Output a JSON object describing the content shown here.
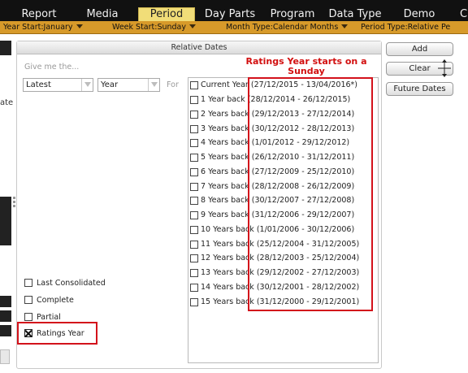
{
  "top_tabs": [
    {
      "label": "Report"
    },
    {
      "label": "Media"
    },
    {
      "label": "Period",
      "active": true
    },
    {
      "label": "Day Parts"
    },
    {
      "label": "Program"
    },
    {
      "label": "Data Type"
    },
    {
      "label": "Demo"
    },
    {
      "label": "C"
    }
  ],
  "sub_bar": [
    {
      "label": "Year Start:January"
    },
    {
      "label": "Week Start:Sunday"
    },
    {
      "label": "Month Type:Calendar Months"
    },
    {
      "label": "Period Type:Relative Pe"
    }
  ],
  "left_strip": {
    "partial_text": "ate"
  },
  "panel": {
    "title": "Relative Dates",
    "give_me_label": "Give me the...",
    "latest_select": "Latest",
    "unit_select": "Year",
    "for_label": "For"
  },
  "periods": [
    {
      "label": "Current Year",
      "range": "(27/12/2015 - 13/04/2016*)"
    },
    {
      "label": "1 Year back",
      "range": "(28/12/2014 - 26/12/2015)"
    },
    {
      "label": "2 Years back",
      "range": "(29/12/2013 - 27/12/2014)"
    },
    {
      "label": "3 Years back",
      "range": "(30/12/2012 - 28/12/2013)"
    },
    {
      "label": "4 Years back",
      "range": "(1/01/2012 - 29/12/2012)"
    },
    {
      "label": "5 Years back",
      "range": "(26/12/2010 - 31/12/2011)"
    },
    {
      "label": "6 Years back",
      "range": "(27/12/2009 - 25/12/2010)"
    },
    {
      "label": "7 Years back",
      "range": "(28/12/2008 - 26/12/2009)"
    },
    {
      "label": "8 Years back",
      "range": "(30/12/2007 - 27/12/2008)"
    },
    {
      "label": "9 Years back",
      "range": "(31/12/2006 - 29/12/2007)"
    },
    {
      "label": "10 Years back",
      "range": "(1/01/2006 - 30/12/2006)"
    },
    {
      "label": "11 Years back",
      "range": "(25/12/2004 - 31/12/2005)"
    },
    {
      "label": "12 Years back",
      "range": "(28/12/2003 - 25/12/2004)"
    },
    {
      "label": "13 Years back",
      "range": "(29/12/2002 - 27/12/2003)"
    },
    {
      "label": "14 Years back",
      "range": "(30/12/2001 - 28/12/2002)"
    },
    {
      "label": "15 Years back",
      "range": "(31/12/2000 - 29/12/2001)"
    }
  ],
  "options": [
    {
      "label": "Last Consolidated",
      "checked": false
    },
    {
      "label": "Complete",
      "checked": false
    },
    {
      "label": "Partial",
      "checked": false
    },
    {
      "label": "Ratings Year",
      "checked": true
    }
  ],
  "buttons": {
    "add": "Add",
    "clear": "Clear",
    "future_dates": "Future Dates"
  },
  "annotation": {
    "text": "Ratings Year starts on a Sunday",
    "color": "#d20f0f"
  },
  "colors": {
    "top_bar": "#111111",
    "active_tab": "#f1dd78",
    "sub_bar": "#d79a2a",
    "annotation_red": "#d3121b"
  }
}
